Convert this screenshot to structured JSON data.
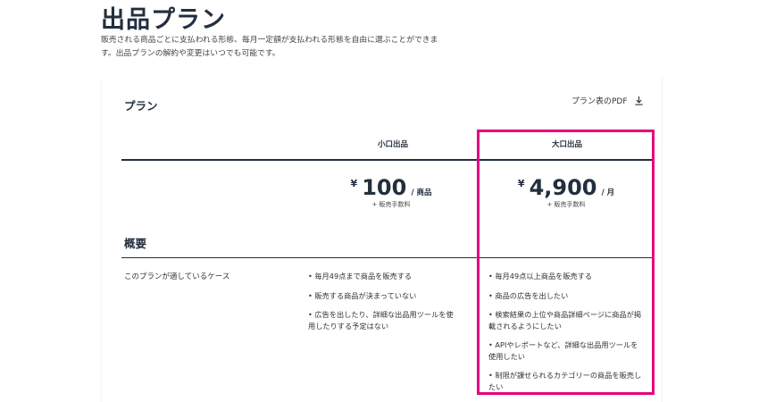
{
  "header": {
    "title": "出品プラン",
    "description": "販売される商品ごとに支払われる形態、毎月一定額が支払われる形態を自由に選ぶことができます。出品プランの解約や変更はいつでも可能です。"
  },
  "card": {
    "title": "プラン",
    "pdf_link": "プラン表のPDF",
    "pdf_icon": "download-icon"
  },
  "plans": [
    {
      "name": "小口出品",
      "currency": "¥",
      "amount": "100",
      "unit": "/ 商品",
      "fee": "+ 販売手数料"
    },
    {
      "name": "大口出品",
      "currency": "¥",
      "amount": "4,900",
      "unit": "/ 月",
      "fee": "+ 販売手数料"
    }
  ],
  "overview": {
    "section_title": "概要",
    "row_label": "このプランが適しているケース",
    "small_plan_points": [
      "• 毎月49点まで商品を販売する",
      "• 販売する商品が決まっていない",
      "• 広告を出したり、詳細な出品用ツールを使用したりする予定はない"
    ],
    "large_plan_points": [
      "• 毎月49点以上商品を販売する",
      "• 商品の広告を出したい",
      "• 検索結果の上位や商品詳細ページに商品が掲載されるようにしたい",
      "• APIやレポートなど、詳細な出品用ツールを使用したい",
      "• 制限が課せられるカテゴリーの商品を販売したい"
    ]
  },
  "colors": {
    "highlight": "#e6007e",
    "text_dark": "#232f3e"
  }
}
